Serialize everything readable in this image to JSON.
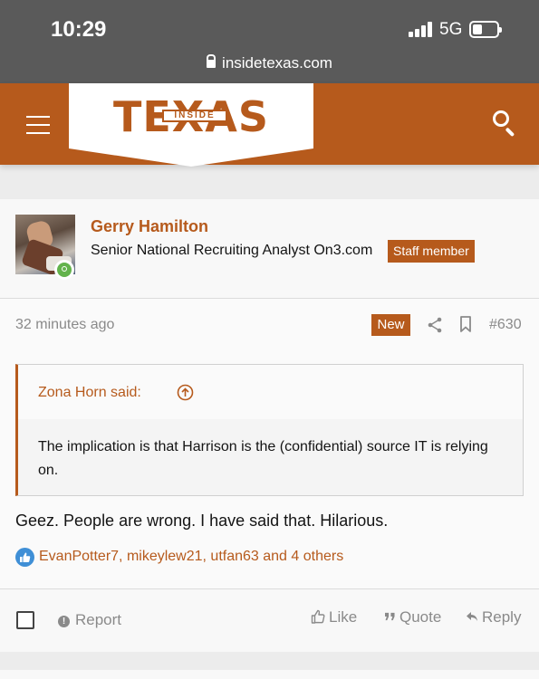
{
  "status_bar": {
    "time": "10:29",
    "network": "5G",
    "url": "insidetexas.com",
    "battery_level": 0.4
  },
  "site_header": {
    "logo_main": "TEXAS",
    "logo_sub": "INSIDE",
    "brand_color": "#b65a1c"
  },
  "post": {
    "author": {
      "name": "Gerry Hamilton",
      "title": "Senior National Recruiting Analyst On3.com",
      "badge": "Staff member",
      "online": true
    },
    "time_ago": "32 minutes ago",
    "new_badge": "New",
    "number": "#630",
    "quote": {
      "author_said": "Zona Horn said:",
      "text": "The implication is that Harrison is the (confidential) source IT is relying on."
    },
    "text": "Geez. People are wrong. I have said that. Hilarious.",
    "reactions": "EvanPotter7, mikeylew21, utfan63 and 4 others"
  },
  "actions": {
    "report": "Report",
    "like": "Like",
    "quote": "Quote",
    "reply": "Reply"
  },
  "icons": {
    "menu": "hamburger-icon",
    "search": "search-icon",
    "share": "share-icon",
    "bookmark": "bookmark-icon",
    "quote_jump": "arrow-up-circle-icon",
    "like_reaction": "thumbs-up-icon"
  }
}
